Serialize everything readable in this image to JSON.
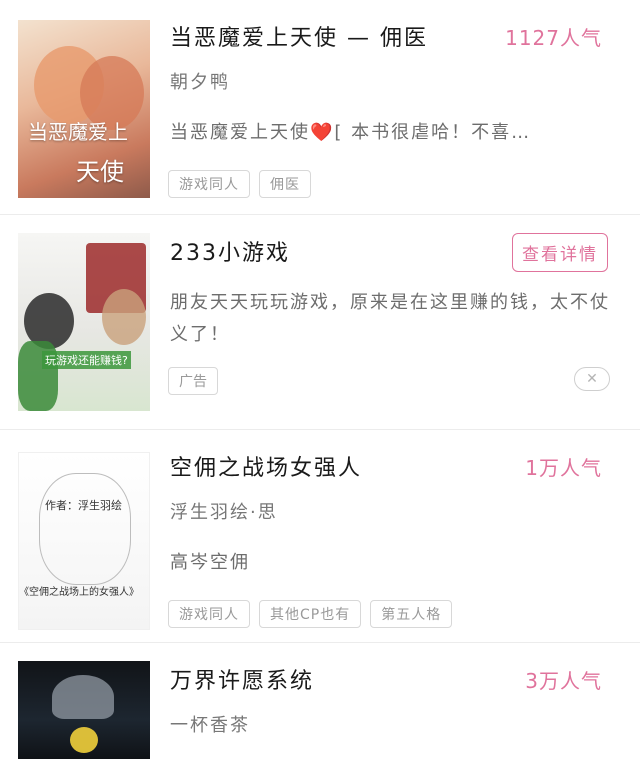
{
  "books": [
    {
      "title": "当恶魔爱上天使 — 佣医",
      "author": "朝夕鸭",
      "popularity": "1127人气",
      "description": "当恶魔爱上天使❤️[ 本书很虐哈！不喜…",
      "tags": [
        "游戏同人",
        "佣医"
      ],
      "cover_text_1": "当恶魔爱上",
      "cover_text_2": "天使"
    },
    {
      "title": "万界许愿系统",
      "author": "一杯香茶",
      "popularity": "3万人气"
    },
    {
      "title": "空佣之战场女强人",
      "author": "浮生羽绘·思",
      "popularity": "1万人气",
      "description": "高岑空佣",
      "tags": [
        "游戏同人",
        "其他CP也有",
        "第五人格"
      ],
      "cover_author": "作者：浮生羽绘",
      "cover_title": "《空佣之战场上的女强人》"
    }
  ],
  "ad": {
    "title": "233小游戏",
    "button": "查看详情",
    "description": "朋友天天玩玩游戏，原来是在这里赚的钱，太不仗义了！",
    "label": "广告",
    "cover_caption": "玩游戏还能赚钱?",
    "close_icon": "close-icon"
  },
  "colors": {
    "accent": "#e0739c"
  }
}
